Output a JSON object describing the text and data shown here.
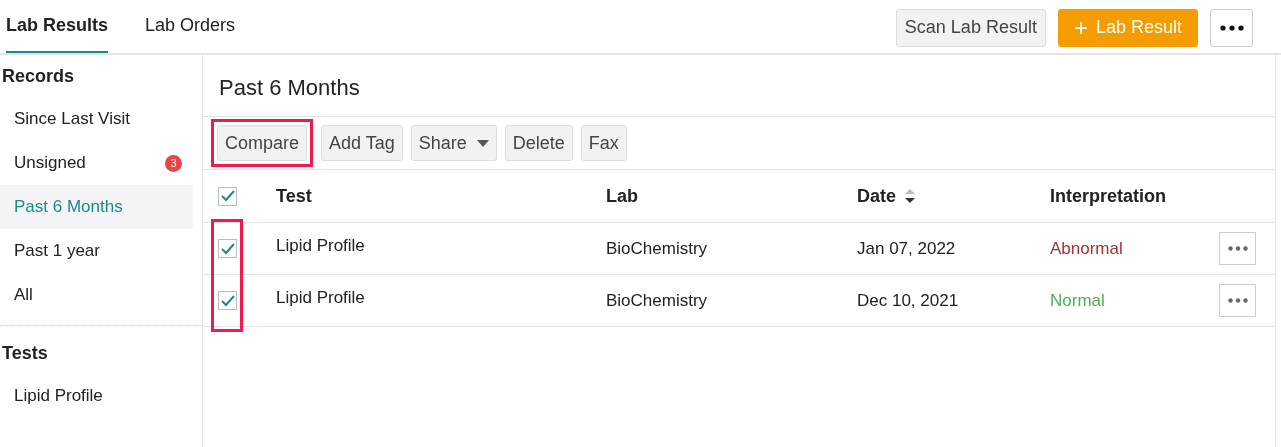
{
  "tabs": [
    {
      "label": "Lab Results",
      "selected": true
    },
    {
      "label": "Lab Orders",
      "selected": false
    }
  ],
  "header_actions": {
    "scan": "Scan Lab Result",
    "add_icon": "+",
    "add": "Lab Result"
  },
  "sidebar": {
    "records_title": "Records",
    "items": [
      {
        "label": "Since Last Visit",
        "selected": false
      },
      {
        "label": "Unsigned",
        "selected": false,
        "badge": "3"
      },
      {
        "label": "Past 6 Months",
        "selected": true
      },
      {
        "label": "Past 1 year",
        "selected": false
      },
      {
        "label": "All",
        "selected": false
      }
    ],
    "tests_title": "Tests",
    "tests": [
      {
        "label": "Lipid Profile",
        "selected": false
      }
    ]
  },
  "main": {
    "title": "Past 6 Months",
    "toolbar": [
      {
        "label": "Compare",
        "kind": "button",
        "highlighted": true
      },
      {
        "label": "Add Tag",
        "kind": "button",
        "highlighted": false
      },
      {
        "label": "Share",
        "kind": "dropdown",
        "highlighted": false
      },
      {
        "label": "Delete",
        "kind": "button",
        "highlighted": false
      },
      {
        "label": "Fax",
        "kind": "button",
        "highlighted": false
      }
    ],
    "table": {
      "select_all_checked": true,
      "checkbox_column_highlighted": true,
      "columns": [
        "Test",
        "Lab",
        "Date",
        "Interpretation"
      ],
      "rows": [
        {
          "checked": true,
          "test": "Lipid Profile",
          "lab": "BioChemistry",
          "date": "Jan 07, 2022",
          "interpretation": "Abnormal",
          "color": "#a83232"
        },
        {
          "checked": true,
          "test": "Lipid Profile",
          "lab": "BioChemistry",
          "date": "Dec 10, 2021",
          "interpretation": "Normal",
          "color": "#4caf50"
        }
      ]
    }
  }
}
